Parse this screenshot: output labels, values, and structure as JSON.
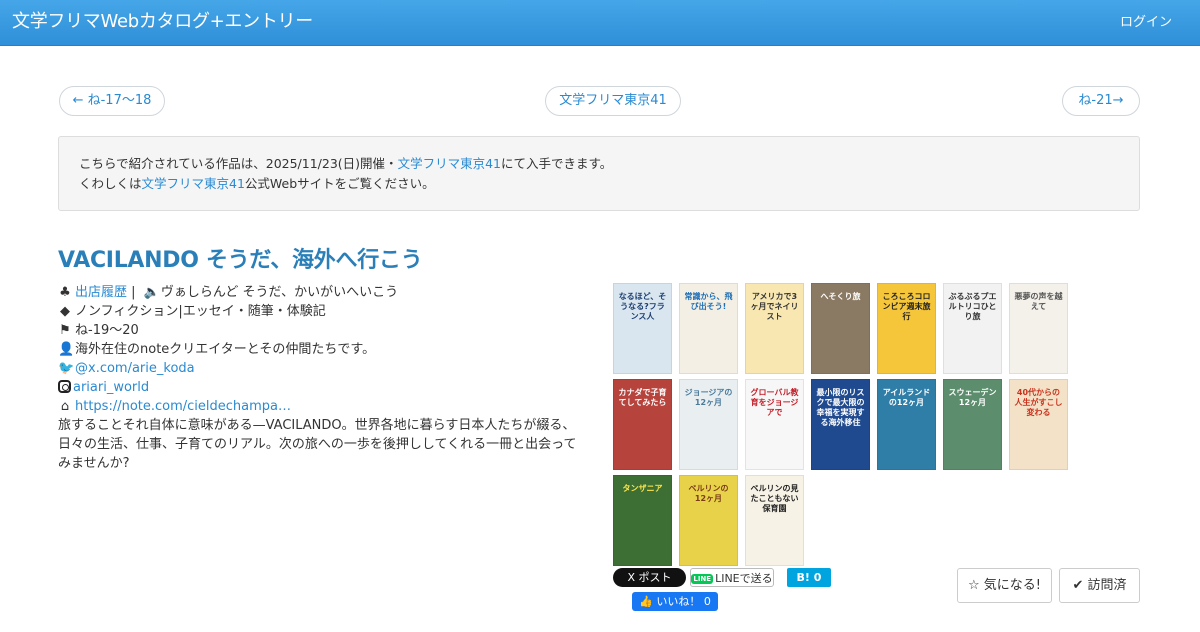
{
  "navbar": {
    "brand": "文学フリマWebカタログ+エントリー",
    "login": "ログイン"
  },
  "pager": {
    "prev": "← ね-17〜18",
    "event": "文学フリマ東京41",
    "next": "ね-21→"
  },
  "notice": {
    "line1_pre": "こちらで紹介されている作品は、2025/11/23(日)開催・",
    "line1_link": "文学フリマ東京41",
    "line1_post": "にて入手できます。",
    "line2_pre": "くわしくは",
    "line2_link": "文学フリマ東京41",
    "line2_post": "公式Webサイトをご覧ください。"
  },
  "booth": {
    "title": "VACILANDO そうだ、海外へ行こう",
    "history_link": "出店履歴",
    "history_sep": "|",
    "reading": "ヴぁしらんど そうだ、かいがいへいこう",
    "genre": "ノンフィクション|エッセイ・随筆・体験記",
    "location": "ね-19〜20",
    "author": "海外在住のnoteクリエイターとその仲間たちです。",
    "x_account": "@x.com/arie_koda",
    "instagram": "ariari_world",
    "website": "https://note.com/cieldechampa…",
    "description": "旅するることそれ自体に意味がある—VACILANDO。世界各地に暮らす日本人たちが綴る、日々の生活、仕事、子育てのリアル。次の旅への一歩を後押ししてくれる一冊と出会ってみませんか?"
  },
  "books": [
    {
      "title": "なるほど、そうなる?フランス人",
      "bg": "#d9e6f0",
      "fg": "#1b3d6e"
    },
    {
      "title": "常識から、飛び出そう!",
      "bg": "#f3efe4",
      "fg": "#1f6fb5"
    },
    {
      "title": "アメリカで3ヶ月でネイリスト",
      "bg": "#f8e7b0",
      "fg": "#333333"
    },
    {
      "title": "へそくり旅",
      "bg": "#8a7a63",
      "fg": "#ffffff"
    },
    {
      "title": "ころころコロンビア週末旅行",
      "bg": "#f6c63a",
      "fg": "#222222"
    },
    {
      "title": "ぶるぶるプエルトリコひとり旅",
      "bg": "#f2f2f2",
      "fg": "#333333"
    },
    {
      "title": "悪夢の声を越えて",
      "bg": "#f4f1ea",
      "fg": "#555555"
    },
    {
      "title": "カナダで子育てしてみたら",
      "bg": "#b7433d",
      "fg": "#ffffff"
    },
    {
      "title": "ジョージアの12ヶ月",
      "bg": "#e9eef0",
      "fg": "#4a7a9c"
    },
    {
      "title": "グローバル教育をジョージアで",
      "bg": "#f7f7f7",
      "fg": "#c21f2a"
    },
    {
      "title": "最小限のリスクで最大限の幸福を実現する海外移住",
      "bg": "#1f4a8f",
      "fg": "#ffffff"
    },
    {
      "title": "アイルランドの12ヶ月",
      "bg": "#2f7ea8",
      "fg": "#ffffff"
    },
    {
      "title": "スウェーデン12ヶ月",
      "bg": "#5c8d6c",
      "fg": "#ffffff"
    },
    {
      "title": "40代からの人生がすこし変わる",
      "bg": "#f3e2c7",
      "fg": "#c8331f"
    },
    {
      "title": "タンザニア",
      "bg": "#3d6f35",
      "fg": "#ffe64a"
    },
    {
      "title": "ベルリンの12ヶ月",
      "bg": "#e8d24a",
      "fg": "#7a3b17"
    },
    {
      "title": "ベルリンの見たこともない保育園",
      "bg": "#f7f2e6",
      "fg": "#222222"
    }
  ],
  "share": {
    "x": "X ポスト",
    "line": "LINEで送る",
    "line_badge": "LINE",
    "hatena": "B! 0",
    "facebook": "👍 いいね！ 0"
  },
  "actions": {
    "favorite": "☆ 気になる!",
    "visited": "✔ 訪問済"
  }
}
